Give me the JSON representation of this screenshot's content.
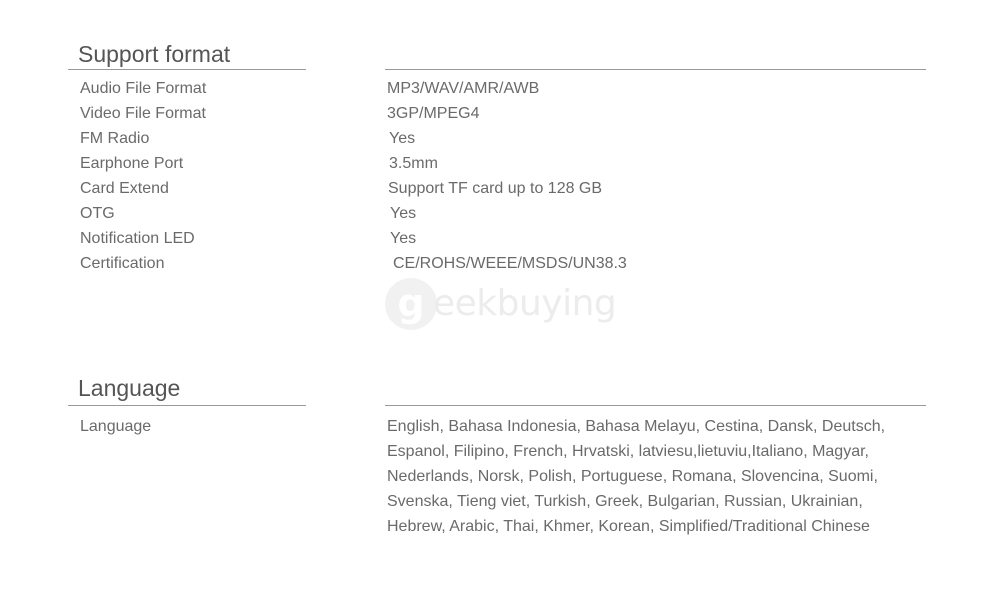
{
  "sections": {
    "support_format": {
      "title": "Support format",
      "rows": [
        {
          "label": "Audio File Format",
          "value": "MP3/WAV/AMR/AWB"
        },
        {
          "label": "Video File Format",
          "value": "3GP/MPEG4"
        },
        {
          "label": "FM Radio",
          "value": "Yes"
        },
        {
          "label": "Earphone Port",
          "value": "3.5mm"
        },
        {
          "label": "Card Extend",
          "value": "Support TF card up to 128 GB"
        },
        {
          "label": "OTG",
          "value": "Yes"
        },
        {
          "label": "Notification LED",
          "value": "Yes"
        },
        {
          "label": "Certification",
          "value": "CE/ROHS/WEEE/MSDS/UN38.3"
        }
      ]
    },
    "language": {
      "title": "Language",
      "label": "Language",
      "lines": [
        "English, Bahasa Indonesia, Bahasa Melayu, Cestina, Dansk, Deutsch,",
        "Espanol, Filipino, French, Hrvatski, latviesu,lietuviu,Italiano, Magyar,",
        "Nederlands, Norsk, Polish, Portuguese, Romana, Slovencina, Suomi,",
        "Svenska, Tieng viet, Turkish, Greek, Bulgarian, Russian, Ukrainian,",
        "Hebrew, Arabic, Thai, Khmer, Korean, Simplified/Traditional Chinese"
      ]
    }
  },
  "watermark": {
    "badge_letter": "g",
    "text": "eekbuying"
  },
  "colors": {
    "text": "#6a6a6a",
    "title": "#555555",
    "rule": "#9a9a9a",
    "watermark": "#dddddd"
  }
}
